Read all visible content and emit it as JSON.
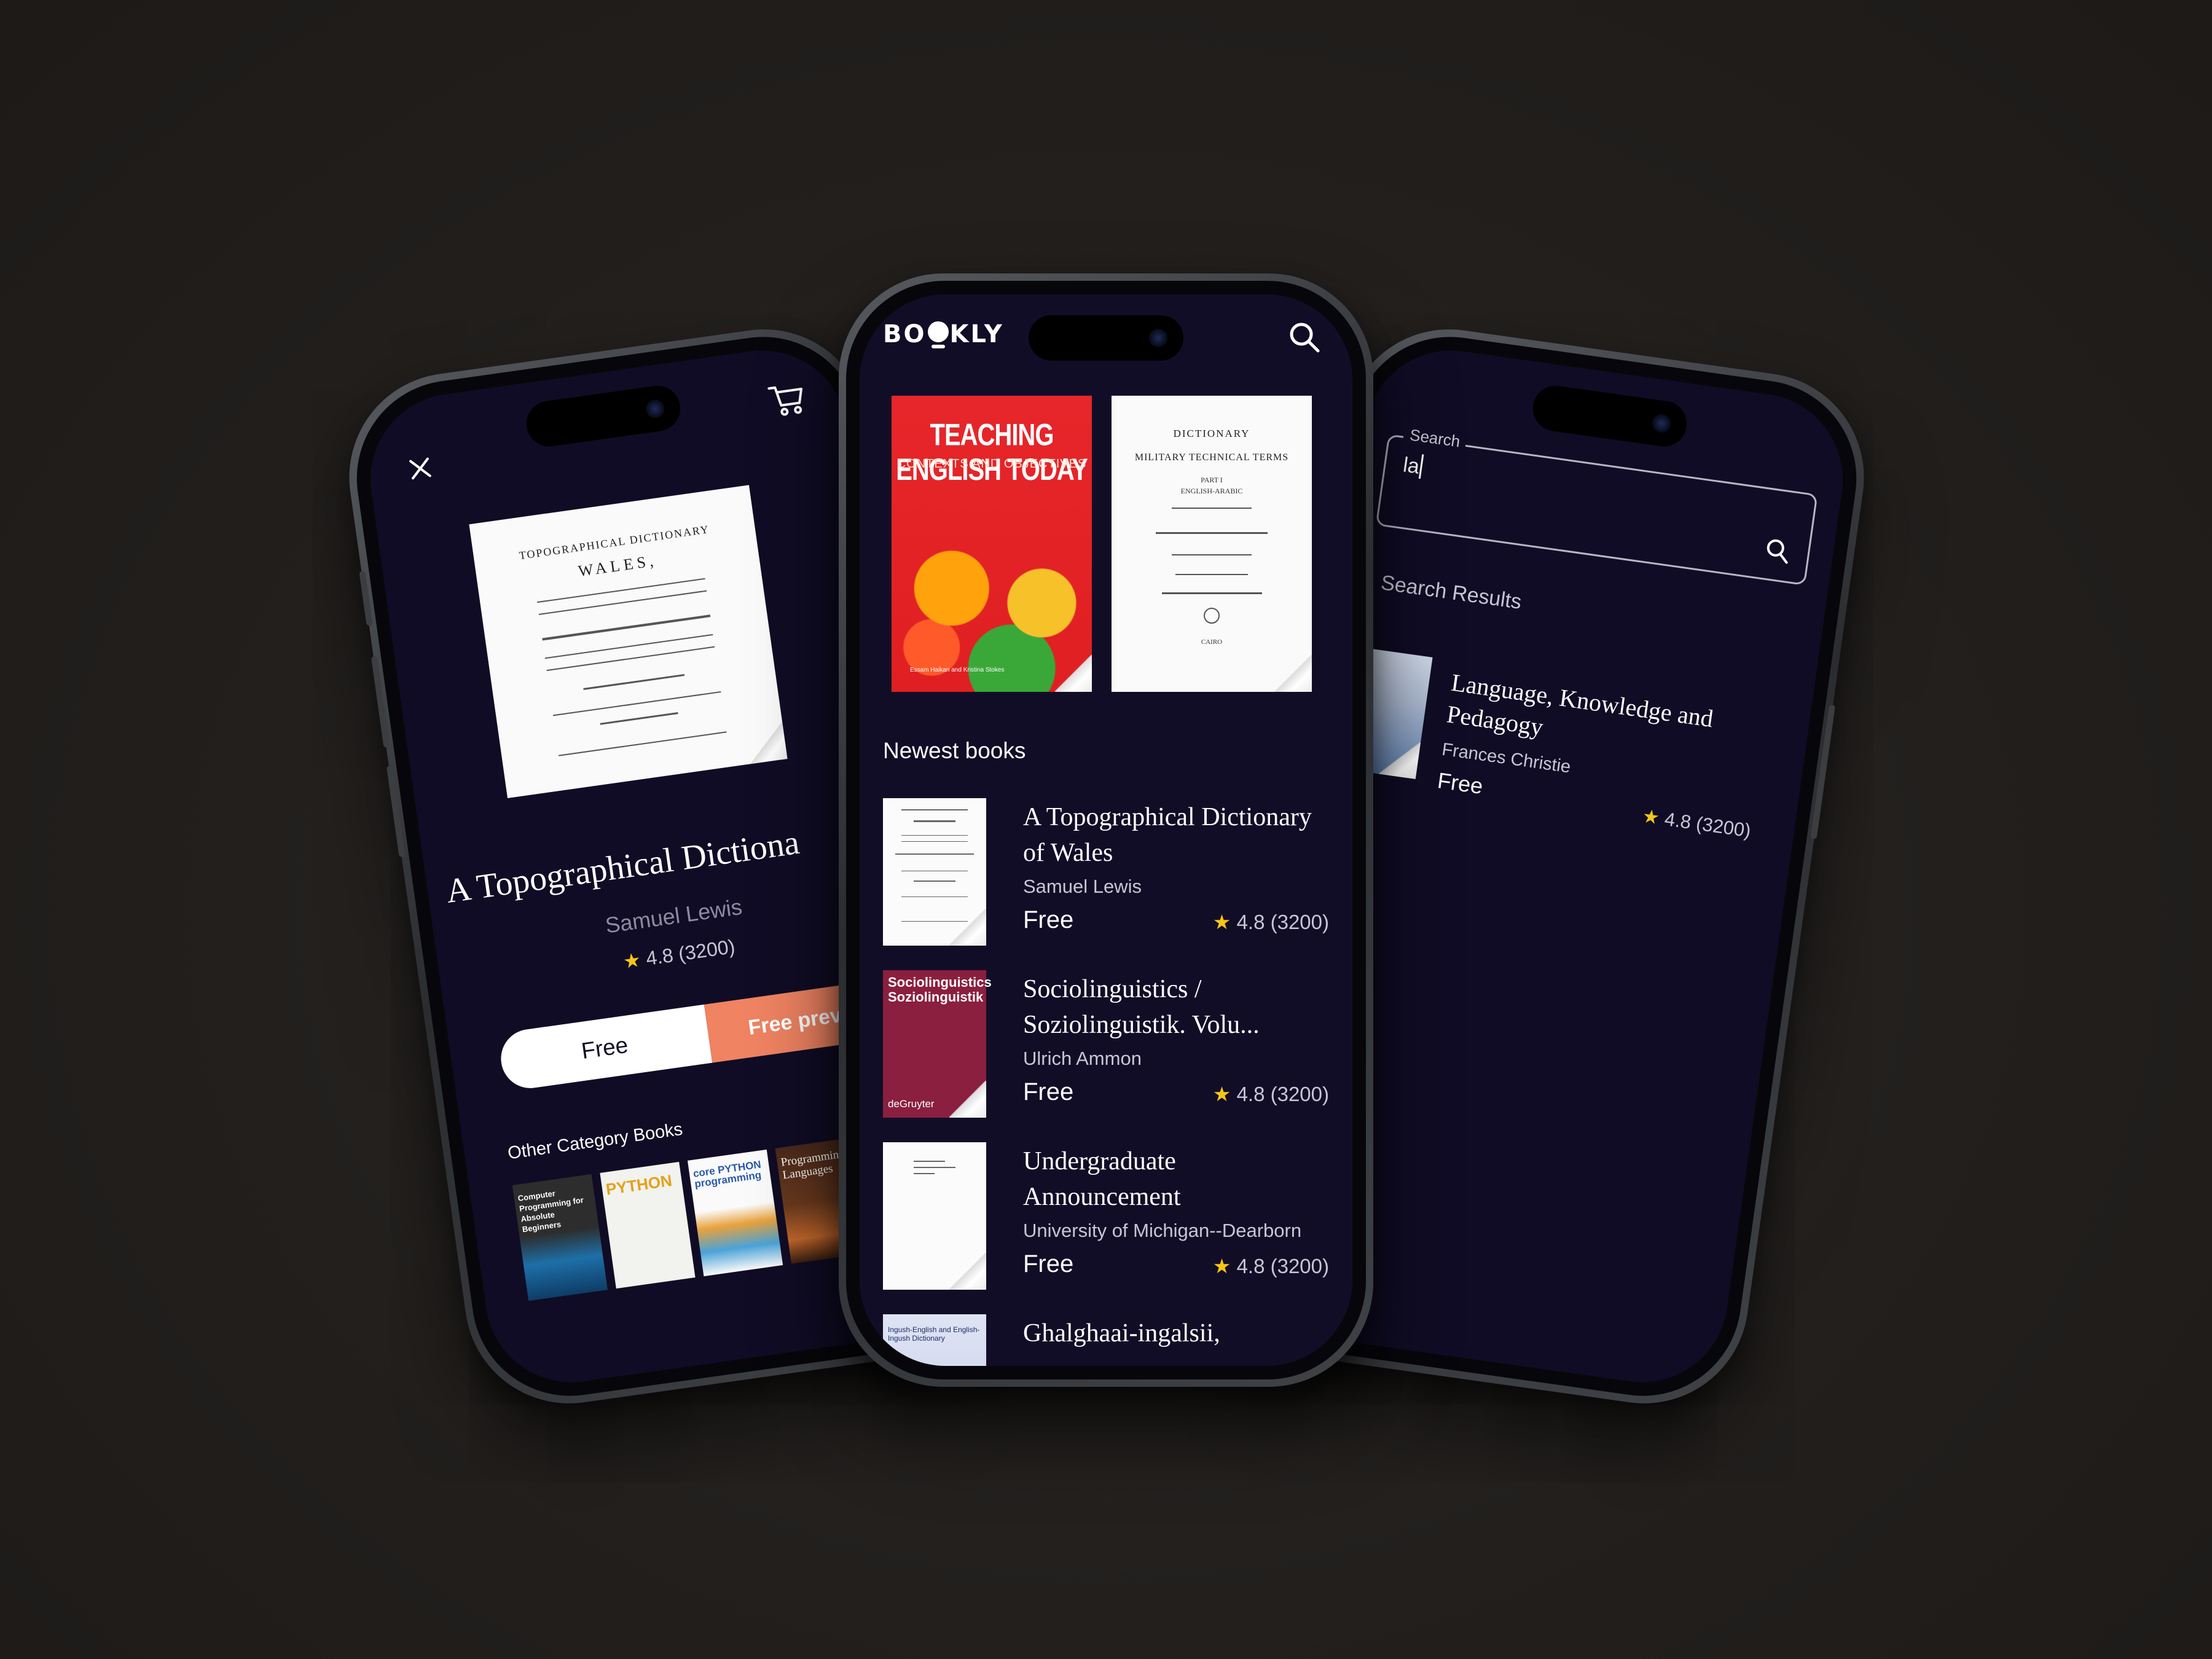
{
  "app": {
    "brand_prefix": "BO",
    "brand_suffix": "KLY"
  },
  "center": {
    "featured": [
      {
        "title": "TEACHING ENGLISH TODAY",
        "subtitle": "CONTEXTS AND OBJECTIVES",
        "authors": "Essam Haikan and Kristina Stokes"
      },
      {
        "line1": "DICTIONARY",
        "line2": "MILITARY TECHNICAL TERMS",
        "line3": "PART I",
        "line4": "ENGLISH-ARABIC",
        "line5": "CAIRO"
      }
    ],
    "section_title": "Newest books",
    "books": [
      {
        "title": "A Topographical Dictionary of Wales",
        "author": "Samuel Lewis",
        "price": "Free",
        "rating": "4.8 (3200)"
      },
      {
        "title": "Sociolinguistics / Soziolinguistik. Volu...",
        "author": "Ulrich Ammon",
        "price": "Free",
        "rating": "4.8 (3200)",
        "cover_title": "Sociolinguistics Soziolinguistik",
        "cover_publisher": "deGruyter"
      },
      {
        "title": "Undergraduate Announcement",
        "author": "University of Michigan--Dearborn",
        "price": "Free",
        "rating": "4.8 (3200)"
      },
      {
        "title": "Ghalghaai-ingalsii,",
        "cover_text": "Ingush-English and English-Ingush Dictionary"
      }
    ]
  },
  "left": {
    "cover_heading": "TOPOGRAPHICAL DICTIONARY",
    "cover_sub": "WALES,",
    "title": "A Topographical Dictiona",
    "author": "Samuel Lewis",
    "rating": "4.8 (3200)",
    "free_label": "Free",
    "preview_label": "Free preview",
    "other_title": "Other Category Books",
    "category_books": [
      {
        "label": "Computer Programming for Absolute Beginners"
      },
      {
        "label": "PYTHON"
      },
      {
        "label": "core PYTHON programming"
      },
      {
        "label": "Programming Languages"
      }
    ]
  },
  "right": {
    "search_label": "Search",
    "search_value": "la",
    "results_title": "Search Results",
    "result": {
      "title": "Language, Knowledge and Pedagogy",
      "author": "Frances Christie",
      "price": "Free",
      "rating": "4.8 (3200)"
    }
  },
  "colors": {
    "screen_bg": "#120d27",
    "accent": "#ef8362",
    "star": "#f5c518"
  }
}
